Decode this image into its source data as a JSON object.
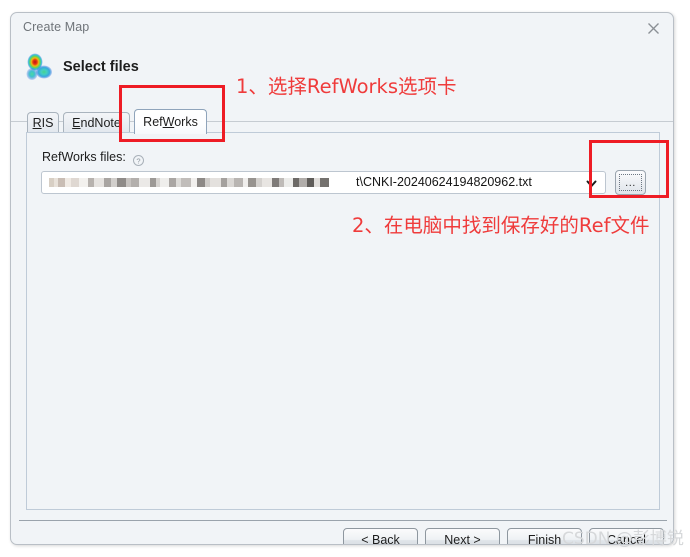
{
  "window": {
    "title": "Create Map",
    "close_icon": "close-icon"
  },
  "header": {
    "heading": "Select files",
    "app_icon": "vosviewer-density-map-icon"
  },
  "tabs": [
    {
      "label": "RIS",
      "mnemonic": "R",
      "active": false
    },
    {
      "label": "EndNote",
      "mnemonic": "E",
      "active": false
    },
    {
      "label": "RefWorks",
      "mnemonic": "W",
      "active": true
    }
  ],
  "panel": {
    "files_label": "RefWorks files:",
    "help_icon": "question-mark-help-icon",
    "file_path_visible": "t\\CNKI-20240624194820962.txt",
    "file_path_censored": true,
    "dropdown_icon": "chevron-down-icon",
    "browse_button_label": "...",
    "browse_icon": "ellipsis-icon"
  },
  "footer": {
    "buttons": [
      {
        "label": "< Back",
        "enabled": true
      },
      {
        "label": "Next >",
        "enabled": true
      },
      {
        "label": "Finish",
        "enabled": true
      },
      {
        "label": "Cancel",
        "enabled": true
      }
    ]
  },
  "annotations": {
    "color": "#ef3b3b",
    "note_1": "1、选择RefWorks选项卡",
    "note_2": "2、在电脑中找到保存好的Ref文件",
    "highlight_boxes": [
      "refworks-tab",
      "browse-file-button"
    ]
  },
  "watermark": {
    "text": "CSDN @彭博锐"
  },
  "colors": {
    "window_background": "#f1f4f7",
    "annotation_red": "#ef3b3b",
    "box_red": "#ee1c25",
    "text": "#1d1d1d",
    "title_text": "#6f7479",
    "watermark": "#d6d8da"
  }
}
